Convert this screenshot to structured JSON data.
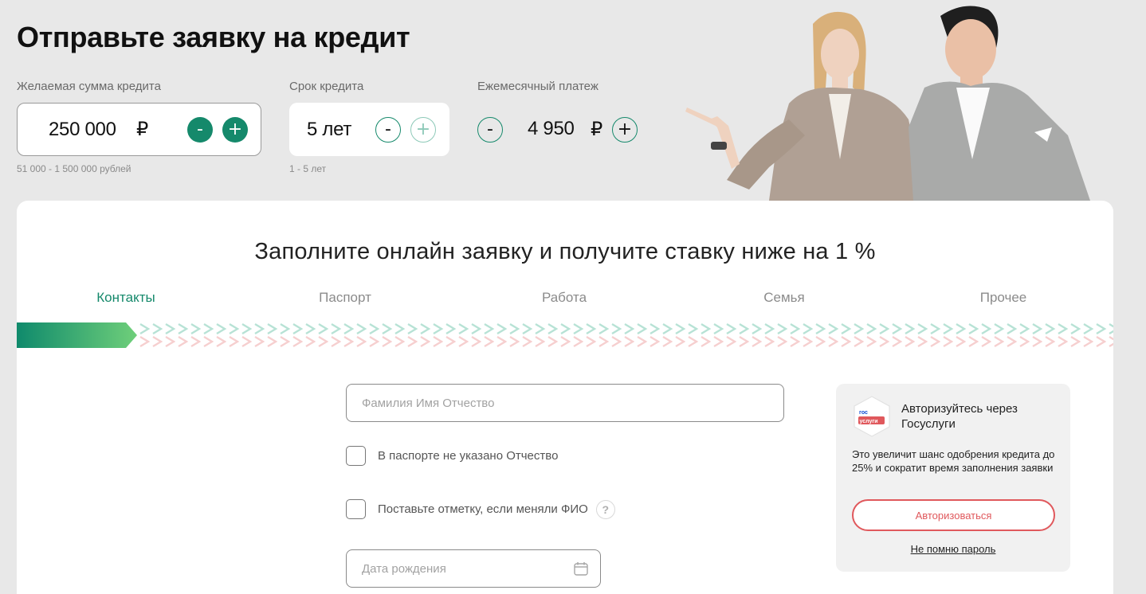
{
  "header": {
    "title": "Отправьте заявку на кредит"
  },
  "calculator": {
    "amount": {
      "label": "Желаемая сумма кредита",
      "value": "250 000",
      "currency": "₽",
      "hint": "51 000 - 1 500 000 рублей",
      "minus": "-",
      "plus": "+"
    },
    "term": {
      "label": "Срок кредита",
      "value": "5 лет",
      "hint": "1 - 5 лет",
      "minus": "-",
      "plus": "+"
    },
    "payment": {
      "label": "Ежемесячный платеж",
      "value": "4 950",
      "currency": "₽",
      "minus": "-",
      "plus": "+"
    }
  },
  "form": {
    "title": "Заполните онлайн заявку и получите ставку ниже на 1 %",
    "steps": [
      {
        "label": "Контакты",
        "active": true
      },
      {
        "label": "Паспорт",
        "active": false
      },
      {
        "label": "Работа",
        "active": false
      },
      {
        "label": "Семья",
        "active": false
      },
      {
        "label": "Прочее",
        "active": false
      }
    ],
    "progress_fraction": 0.11,
    "fio_placeholder": "Фамилия Имя Отчество",
    "no_patronymic_label": "В паспорте не указано Отчество",
    "changed_name_label": "Поставьте отметку, если меняли ФИО",
    "help_glyph": "?",
    "birthdate_placeholder": "Дата рождения"
  },
  "gosuslugi": {
    "logo_top": "гос",
    "logo_bottom": "услуги",
    "title": "Авторизуйтесь через Госуслуги",
    "text": "Это увеличит шанс одобрения кредита до 25% и сократит время заполнения заявки",
    "button": "Авторизоваться",
    "forgot_link": "Не помню пароль"
  },
  "colors": {
    "accent": "#15896b",
    "gos_red": "#e0585c",
    "gos_blue": "#0d4cd3"
  },
  "icons": [
    "calendar-icon",
    "question-icon",
    "gosuslugi-logo-icon"
  ]
}
